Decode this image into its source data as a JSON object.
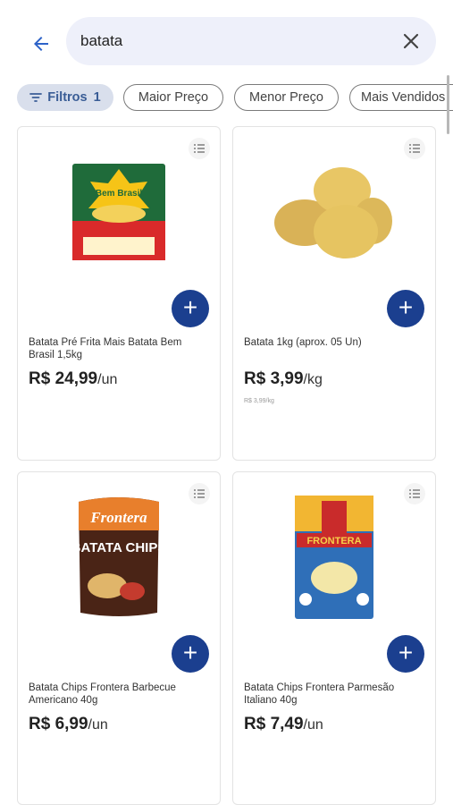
{
  "search": {
    "query": "batata"
  },
  "chips": {
    "filters_label": "Filtros",
    "filters_count": "1",
    "items": [
      "Maior Preço",
      "Menor Preço",
      "Mais Vendidos"
    ]
  },
  "colors": {
    "primary": "#1b3f8f",
    "chip_active_bg": "#d9dfec",
    "search_bg": "#eef0fa"
  },
  "products": [
    {
      "name": "Batata Pré Frita Mais Batata Bem Brasil 1,5kg",
      "price": "R$ 24,99",
      "unit": "/un",
      "brand_text": "Bem Brasil"
    },
    {
      "name": "Batata 1kg (aprox. 05 Un)",
      "price": "R$ 3,99",
      "unit": "/kg",
      "sub_price": "R$ 3,99/kg"
    },
    {
      "name": "Batata Chips Frontera Barbecue Americano 40g",
      "price": "R$ 6,99",
      "unit": "/un",
      "brand_text": "Frontera",
      "pack_text": "BATATA CHIPS"
    },
    {
      "name": "Batata Chips Frontera Parmesão Italiano 40g",
      "price": "R$ 7,49",
      "unit": "/un",
      "brand_text": "FRONTERA"
    }
  ]
}
